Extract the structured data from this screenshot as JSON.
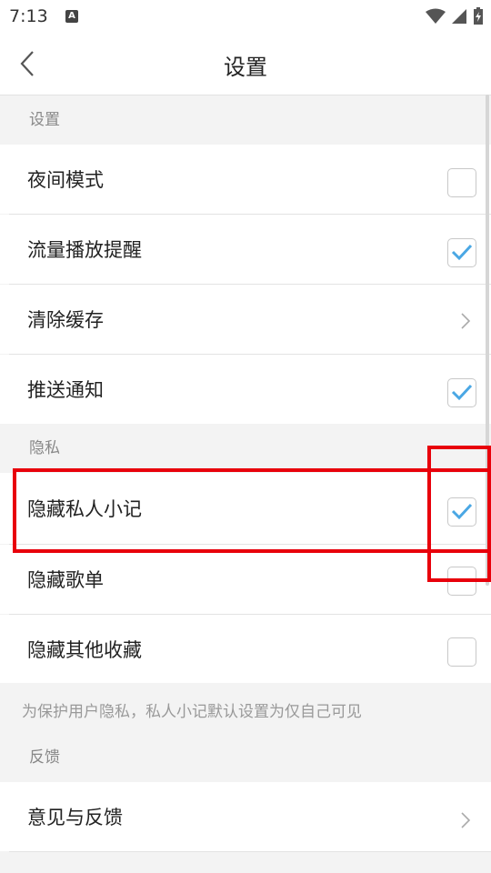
{
  "status_bar": {
    "time": "7:13",
    "notification_icon": "a-icon"
  },
  "header": {
    "title": "设置"
  },
  "sections": {
    "settings": "设置",
    "privacy": "隐私",
    "feedback": "反馈"
  },
  "rows": {
    "night_mode": {
      "label": "夜间模式",
      "checked": false
    },
    "data_alert": {
      "label": "流量播放提醒",
      "checked": true
    },
    "clear_cache": {
      "label": "清除缓存"
    },
    "push": {
      "label": "推送通知",
      "checked": true
    },
    "hide_notes": {
      "label": "隐藏私人小记",
      "checked": true
    },
    "hide_playlists": {
      "label": "隐藏歌单",
      "checked": false
    },
    "hide_others": {
      "label": "隐藏其他收藏",
      "checked": false
    },
    "feedback": {
      "label": "意见与反馈"
    }
  },
  "privacy_note": "为保护用户隐私，私人小记默认设置为仅自己可见",
  "colors": {
    "check": "#4aa7e4",
    "highlight": "#e8000b"
  }
}
